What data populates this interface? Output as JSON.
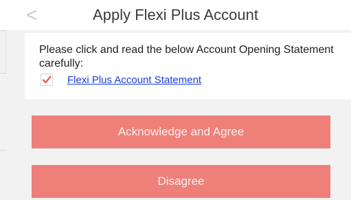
{
  "header": {
    "back_icon": "chevron-left-icon",
    "back_glyph": "<",
    "title": "Apply Flexi Plus Account"
  },
  "statement": {
    "intro": "Please click and read the below Account Opening Statement carefully:",
    "checked": true,
    "check_icon": "checkmark-icon",
    "link_label": "Flexi Plus Account Statement"
  },
  "actions": {
    "agree_label": "Acknowledge and Agree",
    "disagree_label": "Disagree"
  },
  "colors": {
    "button_bg": "#ef8079",
    "link": "#1a3fd8",
    "check": "#e5615b",
    "page_bg": "#f2f2f3"
  }
}
